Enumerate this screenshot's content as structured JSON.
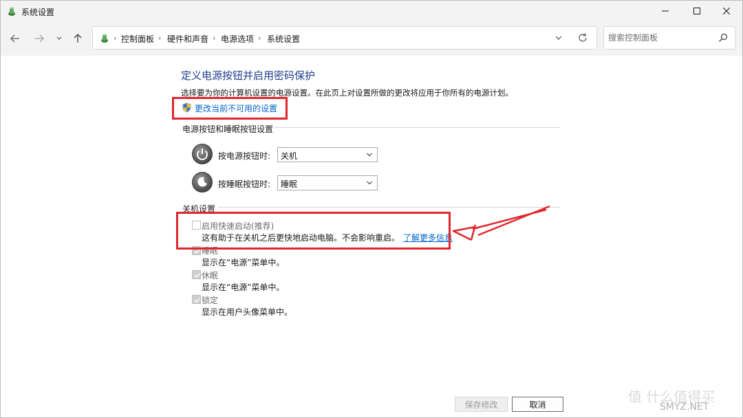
{
  "window": {
    "title": "系统设置"
  },
  "nav": {
    "breadcrumbs": [
      "控制面板",
      "硬件和声音",
      "电源选项",
      "系统设置"
    ],
    "search_placeholder": "搜索控制面板"
  },
  "content": {
    "title": "定义电源按钮并启用密码保护",
    "description": "选择要为你的计算机设置的电源设置。在此页上对设置所做的更改将应用于你所有的电源计划。",
    "change_link": "更改当前不可用的设置"
  },
  "power_buttons": {
    "section_title": "电源按钮和睡眠按钮设置",
    "rows": [
      {
        "label": "按电源按钮时:",
        "value": "关机"
      },
      {
        "label": "按睡眠按钮时:",
        "value": "睡眠"
      }
    ]
  },
  "shutdown": {
    "section_title": "关机设置",
    "options": [
      {
        "label": "启用快速启动(推荐)",
        "description": "这有助于在关机之后更快地启动电脑。不会影响重启。",
        "link": "了解更多信息",
        "checked": false
      },
      {
        "label": "睡眠",
        "description": "显示在“电源”菜单中。",
        "checked": true
      },
      {
        "label": "休眠",
        "description": "显示在“电源”菜单中。",
        "checked": true
      },
      {
        "label": "锁定",
        "description": "显示在用户头像菜单中。",
        "checked": true
      }
    ]
  },
  "footer": {
    "save_label": "保存修改",
    "cancel_label": "取消"
  },
  "watermark": {
    "text": "值 什么值得买",
    "sub": "SMYZ.NET"
  },
  "colors": {
    "title_blue": "#1e3e8c",
    "link_blue": "#0066cc",
    "annotation_red": "#e0262b"
  }
}
